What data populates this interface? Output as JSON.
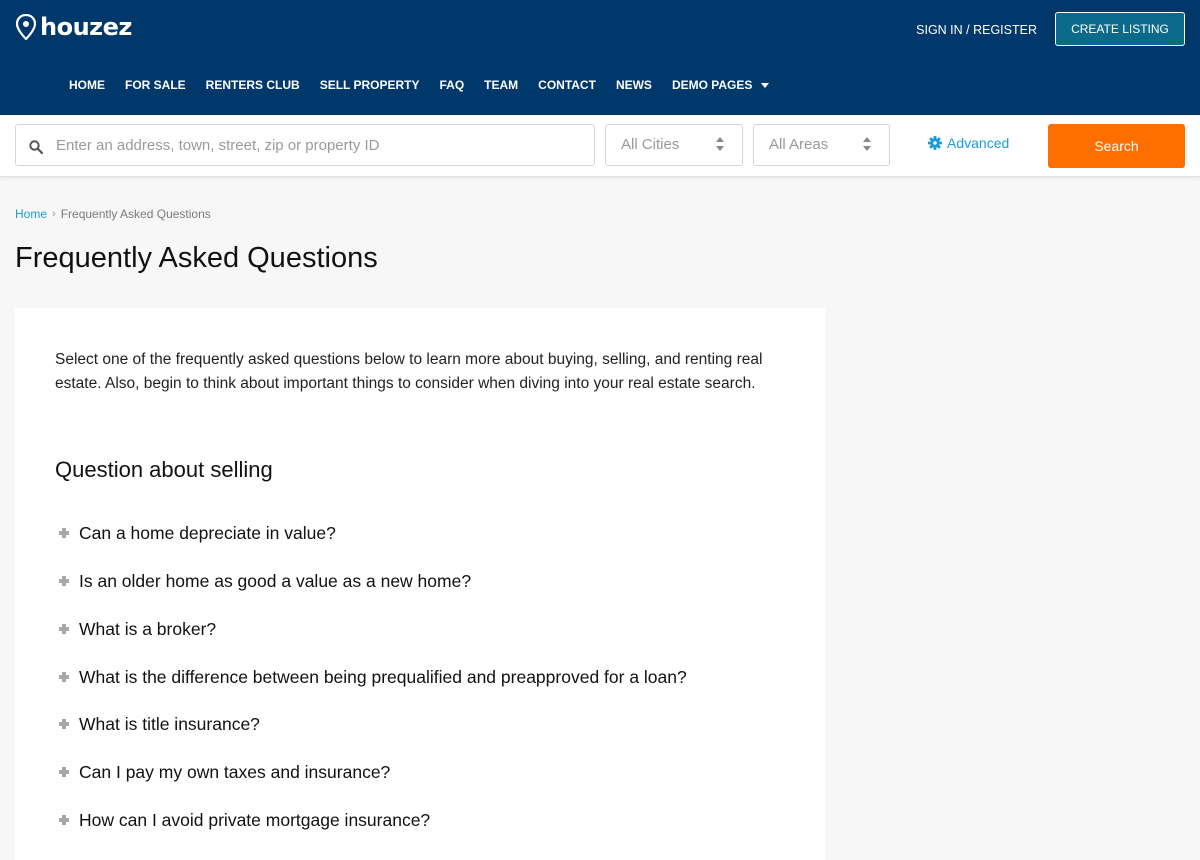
{
  "header": {
    "logo_text": "houzez",
    "signin_label": "SIGN IN / REGISTER",
    "create_listing_label": "CREATE LISTING",
    "nav": [
      {
        "label": "HOME"
      },
      {
        "label": "FOR SALE"
      },
      {
        "label": "RENTERS CLUB"
      },
      {
        "label": "SELL PROPERTY"
      },
      {
        "label": "FAQ"
      },
      {
        "label": "TEAM"
      },
      {
        "label": "CONTACT"
      },
      {
        "label": "NEWS"
      },
      {
        "label": "DEMO PAGES"
      }
    ]
  },
  "search": {
    "placeholder": "Enter an address, town, street, zip or property ID",
    "cities_selected": "All Cities",
    "areas_selected": "All Areas",
    "advanced_label": "Advanced",
    "search_button_label": "Search"
  },
  "breadcrumb": {
    "home": "Home",
    "separator": "›",
    "current": "Frequently Asked Questions"
  },
  "page": {
    "title": "Frequently Asked Questions",
    "intro": "Select one of the frequently asked questions below to learn more about buying, selling, and renting real estate. Also, begin to think about important things to consider when diving into your real estate search.",
    "section_heading": "Question about selling",
    "faqs": [
      {
        "question": "Can a home depreciate in value?"
      },
      {
        "question": "Is an older home as good a value as a new home?"
      },
      {
        "question": "What is a broker?"
      },
      {
        "question": "What is the difference between being prequalified and preapproved for a loan?"
      },
      {
        "question": "What is title insurance?"
      },
      {
        "question": "Can I pay my own taxes and insurance?"
      },
      {
        "question": "How can I avoid private mortgage insurance?"
      }
    ]
  },
  "colors": {
    "header_bg": "#00386c",
    "accent_blue": "#1a9bd7",
    "search_button": "#ff6e00",
    "page_bg": "#f7f7f7"
  }
}
